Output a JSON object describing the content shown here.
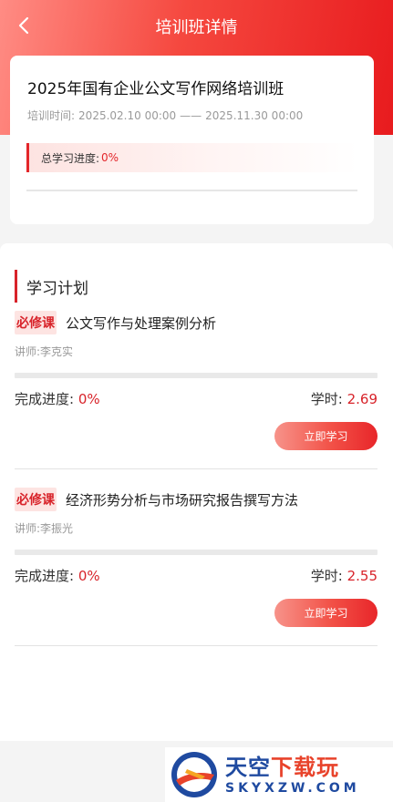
{
  "nav": {
    "title": "培训班详情"
  },
  "summary": {
    "title": "2025年国有企业公文写作网络培训班",
    "period_label": "培训时间:",
    "period_start": "2025.02.10 00:00",
    "period_sep": "——",
    "period_end": "2025.11.30 00:00",
    "progress_label": "总学习进度:",
    "progress_value": "0%",
    "progress_fraction": 0
  },
  "plan": {
    "heading": "学习计划",
    "courses": [
      {
        "tag": "必修课",
        "name": "公文写作与处理案例分析",
        "teacher": "讲师:李克实",
        "progress_label": "完成进度:",
        "progress_value": "0%",
        "progress_fraction": 0,
        "hours_label": "学时:",
        "hours_value": "2.69",
        "button": "立即学习"
      },
      {
        "tag": "必修课",
        "name": "经济形势分析与市场研究报告撰写方法",
        "teacher": "讲师:李振光",
        "progress_label": "完成进度:",
        "progress_value": "0%",
        "progress_fraction": 0,
        "hours_label": "学时:",
        "hours_value": "2.55",
        "button": "立即学习"
      }
    ]
  },
  "watermark": {
    "main_a": "天空",
    "main_b": "下载玩",
    "sub": "SKYXZW.COM"
  },
  "colors": {
    "accent": "#e3262a",
    "tag_bg": "#fde4e2",
    "brand_blue": "#1f4aa0"
  }
}
